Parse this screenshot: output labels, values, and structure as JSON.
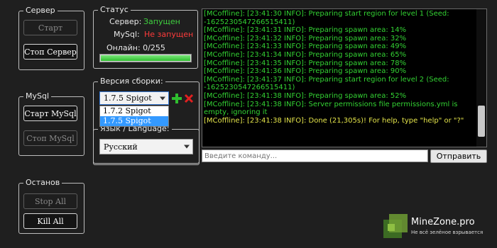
{
  "server": {
    "title": "Сервер",
    "start_label": "Старт",
    "stop_label": "Стоп Сервер"
  },
  "mysql": {
    "title": "MySql",
    "start_label": "Старт MySql",
    "stop_label": "Стоп MySql"
  },
  "shutdown": {
    "title": "Останов",
    "stop_all_label": "Stop All",
    "kill_all_label": "Kill All"
  },
  "status": {
    "title": "Статус",
    "server_label": "Сервер:",
    "server_value": "Запущен",
    "mysql_label": "MySql:",
    "mysql_value": "Не запущен",
    "online_label": "Онлайн: 0/255",
    "online_progress": 1.0,
    "colors": {
      "running": "#3fd13f",
      "stopped": "#ff3b3b",
      "progress": "#3cd13c"
    }
  },
  "build": {
    "title": "Версия сборки:",
    "selected": "1.7.5 Spigot",
    "options": [
      "1.7.2 Spigot",
      "1.7.5 Spigot"
    ],
    "add_icon": "plus-icon",
    "remove_icon": "x-icon"
  },
  "language": {
    "title": "Язык / Language:",
    "selected": "Русский"
  },
  "console": {
    "lines": [
      {
        "text": "[MCoffline]: [23:41:30 INFO]: Preparing start region for level 1 (Seed: -1625230547266515411)",
        "type": "info"
      },
      {
        "text": "[MCoffline]: [23:41:31 INFO]: Preparing spawn area: 14%",
        "type": "info"
      },
      {
        "text": "[MCoffline]: [23:41:32 INFO]: Preparing spawn area: 32%",
        "type": "info"
      },
      {
        "text": "[MCoffline]: [23:41:33 INFO]: Preparing spawn area: 49%",
        "type": "info"
      },
      {
        "text": "[MCoffline]: [23:41:34 INFO]: Preparing spawn area: 65%",
        "type": "info"
      },
      {
        "text": "[MCoffline]: [23:41:35 INFO]: Preparing spawn area: 78%",
        "type": "info"
      },
      {
        "text": "[MCoffline]: [23:41:36 INFO]: Preparing spawn area: 90%",
        "type": "info"
      },
      {
        "text": "[MCoffline]: [23:41:37 INFO]: Preparing start region for level 2 (Seed: -1625230547266515411)",
        "type": "info"
      },
      {
        "text": "[MCoffline]: [23:41:38 INFO]: Preparing spawn area: 52%",
        "type": "info"
      },
      {
        "text": "[MCoffline]: [23:41:38 INFO]: Server permissions file permissions.yml is empty, ignoring it",
        "type": "info"
      },
      {
        "text": "[MCoffline]: [23:41:38 INFO]: Done (21,305s)! For help, type \"help\" or \"?\"",
        "type": "warn"
      }
    ],
    "input_placeholder": "Введите команду...",
    "send_label": "Отправить"
  },
  "watermark": {
    "brand": "MineZone.pro",
    "tagline": "Не всё зелёное взрывается"
  }
}
